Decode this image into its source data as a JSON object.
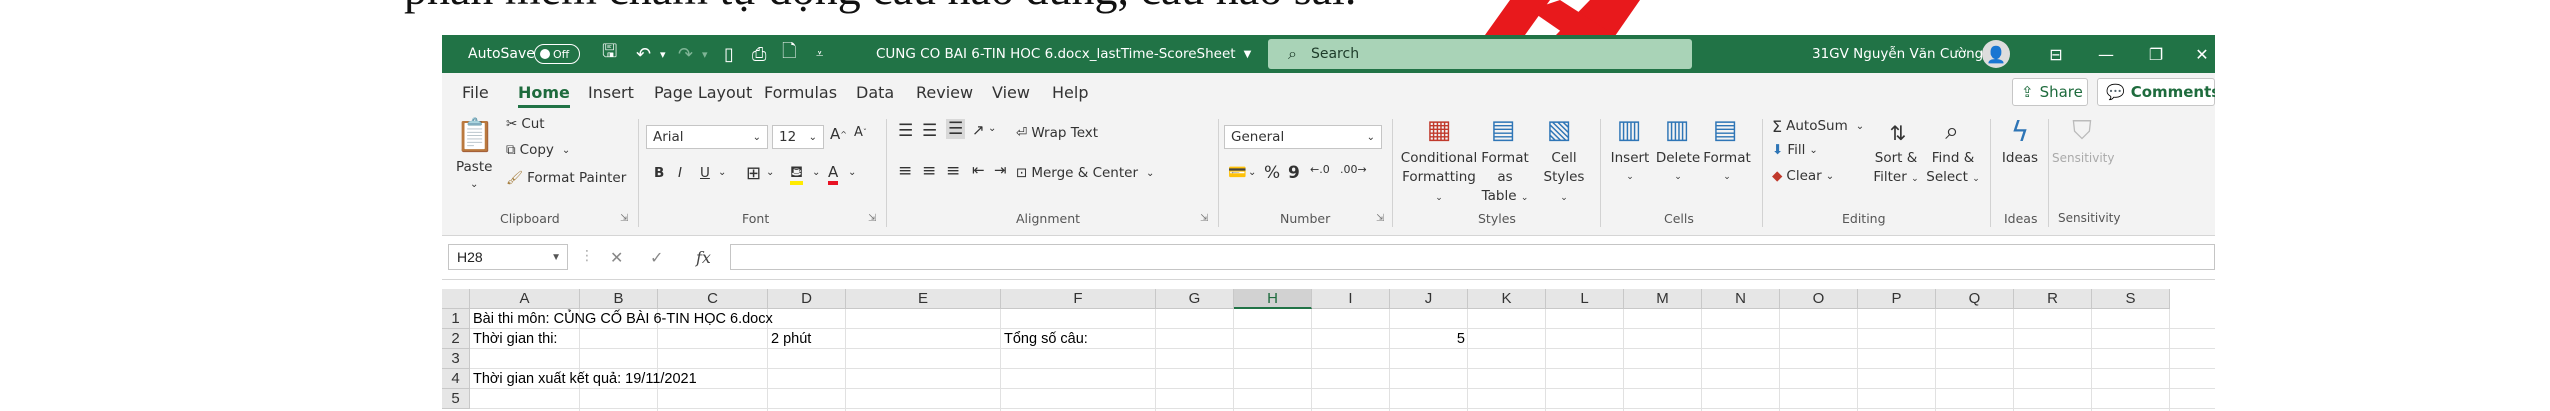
{
  "background_doc": {
    "text": "phần mềm chấm tự động câu nào đúng, câu nào sai."
  },
  "titlebar": {
    "autosave_label": "AutoSave",
    "autosave_state": "Off",
    "doc_title": "CUNG CO BAI 6-TIN HOC 6.docx_lastTime-ScoreSheet",
    "search_placeholder": "Search",
    "user_name": "31GV Nguyễn Văn Cường"
  },
  "tabs": [
    "File",
    "Home",
    "Insert",
    "Page Layout",
    "Formulas",
    "Data",
    "Review",
    "View",
    "Help"
  ],
  "active_tab": "Home",
  "actions": {
    "share": "Share",
    "comments": "Comments"
  },
  "ribbon": {
    "clipboard": {
      "label": "Clipboard",
      "paste": "Paste",
      "cut": "Cut",
      "copy": "Copy",
      "format_painter": "Format Painter"
    },
    "font": {
      "label": "Font",
      "font_name": "Arial",
      "font_size": "12",
      "bold": "B",
      "italic": "I",
      "underline": "U"
    },
    "alignment": {
      "label": "Alignment",
      "wrap_text": "Wrap Text",
      "merge_center": "Merge & Center"
    },
    "number": {
      "label": "Number",
      "format": "General",
      "percent": "%",
      "comma": "9"
    },
    "styles": {
      "label": "Styles",
      "conditional_1": "Conditional",
      "conditional_2": "Formatting",
      "format_table_1": "Format as",
      "format_table_2": "Table",
      "cell_styles_1": "Cell",
      "cell_styles_2": "Styles"
    },
    "cells": {
      "label": "Cells",
      "insert": "Insert",
      "delete": "Delete",
      "format": "Format"
    },
    "editing": {
      "label": "Editing",
      "autosum": "AutoSum",
      "fill": "Fill",
      "clear": "Clear",
      "sort_1": "Sort &",
      "sort_2": "Filter",
      "find_1": "Find &",
      "find_2": "Select"
    },
    "ideas": {
      "label": "Ideas",
      "button": "Ideas"
    },
    "sensitivity": {
      "label": "Sensitivity",
      "button": "Sensitivity"
    }
  },
  "formula_bar": {
    "name_box": "H28",
    "fx": "fx",
    "value": ""
  },
  "grid": {
    "columns": [
      "A",
      "B",
      "C",
      "D",
      "E",
      "F",
      "G",
      "H",
      "I",
      "J",
      "K",
      "L",
      "M",
      "N",
      "O",
      "P",
      "Q",
      "R",
      "S"
    ],
    "selected_column": "H",
    "rows": [
      "1",
      "2",
      "3",
      "4",
      "5"
    ],
    "cells": {
      "A1": "Bài thi môn: CỦNG CỐ BÀI 6-TIN HỌC 6.docx",
      "A2": "Thời gian thi:",
      "D2": "2 phút",
      "F2": "Tổng số câu:",
      "J2": "5",
      "A4": "Thời gian xuất kết quả: 19/11/2021"
    }
  },
  "colors": {
    "accent": "#217346",
    "ribbon_bg": "#f3f3f3",
    "search_bg": "#a9d3b7"
  }
}
